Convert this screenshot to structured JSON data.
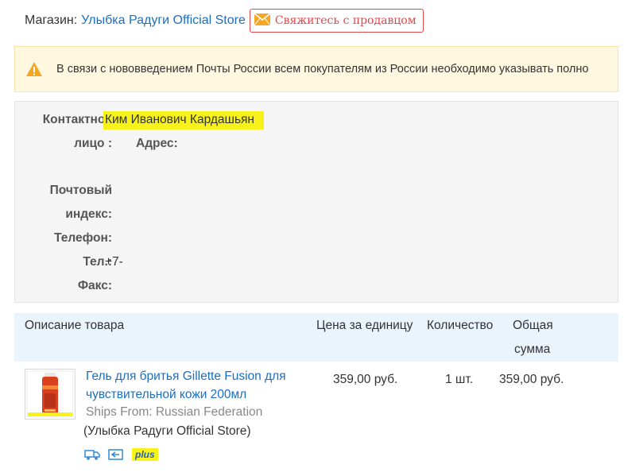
{
  "store": {
    "label": "Магазин:",
    "name": "Улыбка Радуги Official Store",
    "contact_button": "Свяжитесь с продавцом"
  },
  "notice": {
    "text": "В связи с нововведением Почты России всем покупателям из России необходимо указывать полно"
  },
  "address": {
    "contact_label_1": "Контактное",
    "contact_label_2": "лицо :",
    "contact_value": "Ким Иванович Кардашьян",
    "address_label": "Адрес:",
    "postal_label_1": "Почтовый",
    "postal_label_2": "индекс:",
    "phone_label": "Телефон:",
    "tel_label": "Тел.:",
    "tel_value": "+7-",
    "fax_label": "Факс:"
  },
  "table": {
    "col_description": "Описание товара",
    "col_price": "Цена за единицу",
    "col_quantity": "Количество",
    "col_total_1": "Общая",
    "col_total_2": "сумма"
  },
  "item": {
    "title": "Гель для бритья Gillette Fusion для чувствительной кожи 200мл",
    "ships_from": "Ships From: Russian Federation",
    "store": "(Улыбка Радуги Official Store)",
    "price": "359,00 руб.",
    "quantity": "1 шт.",
    "total": "359,00 руб.",
    "plus_badge": "plus"
  },
  "colors": {
    "link": "#1a6fc4",
    "contact_button": "#e0474c",
    "highlight": "#f7f21a",
    "warning": "#f5a623"
  },
  "icons": [
    "envelope-icon",
    "warning-icon",
    "delivery-truck-icon",
    "return-icon"
  ]
}
